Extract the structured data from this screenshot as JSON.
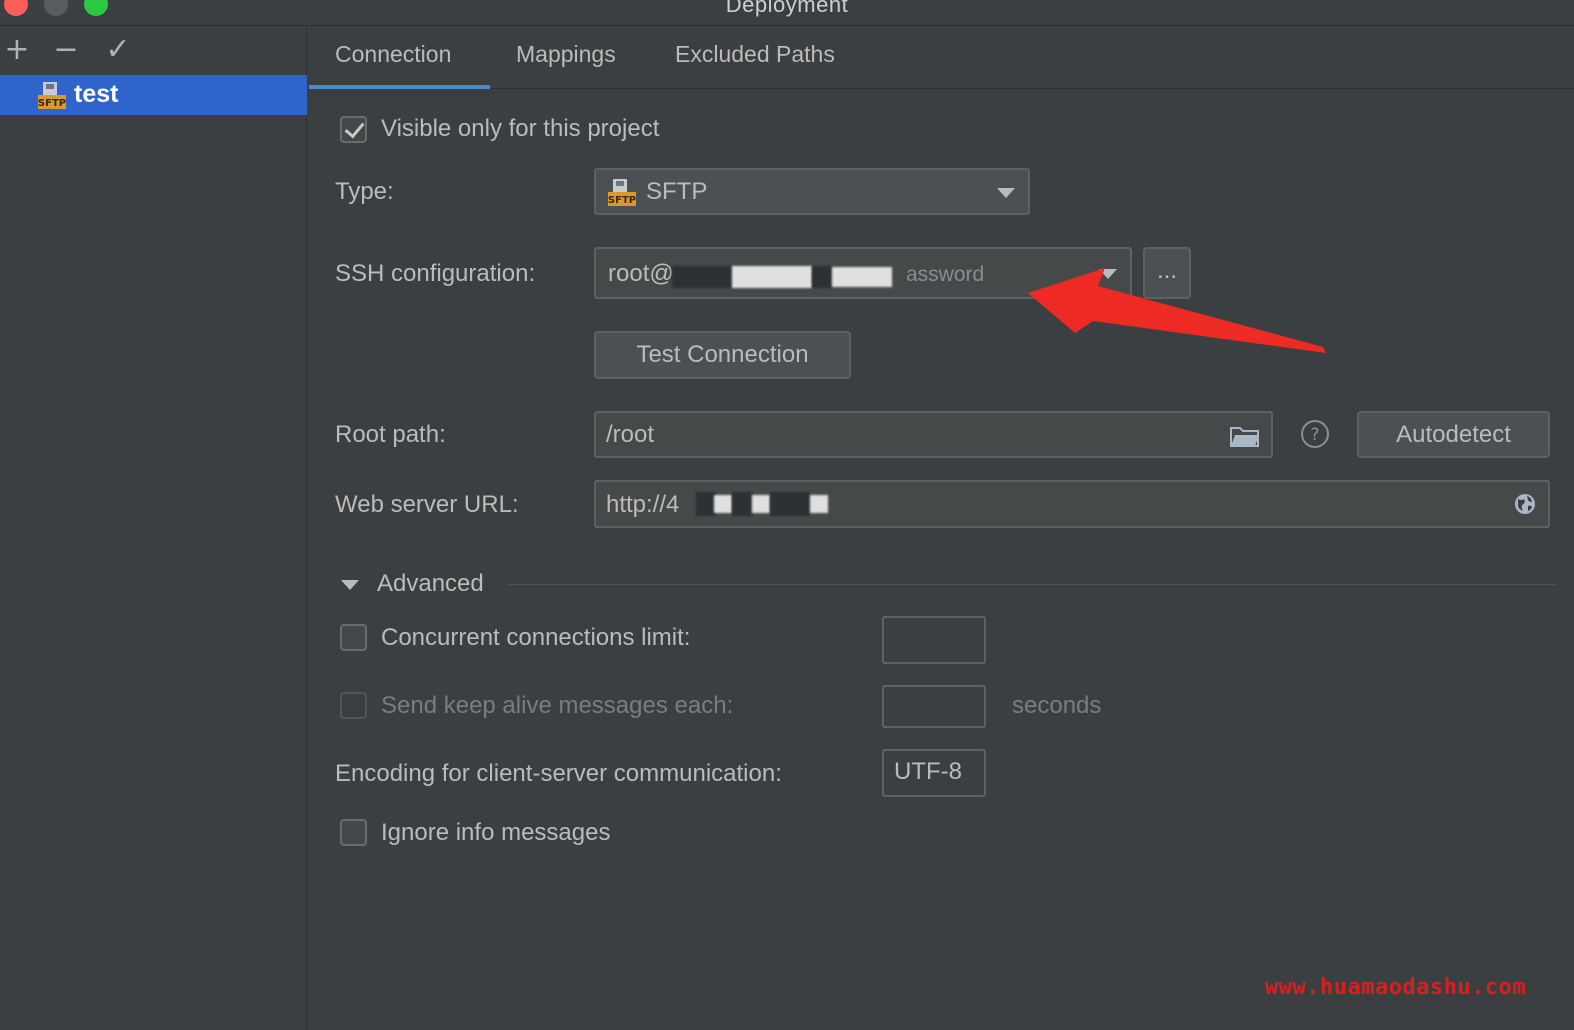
{
  "window": {
    "title": "Deployment"
  },
  "toolbar": {
    "add_symbol": "+",
    "remove_symbol": "−",
    "apply_symbol": "✓"
  },
  "servers": [
    {
      "name": "test",
      "icon": "sftp-icon",
      "icon_text": "SFTP"
    }
  ],
  "tabs": [
    {
      "label": "Connection",
      "active": true
    },
    {
      "label": "Mappings",
      "active": false
    },
    {
      "label": "Excluded Paths",
      "active": false
    }
  ],
  "connection": {
    "visible_only_label": "Visible only for this project",
    "visible_only_checked": true,
    "type_label": "Type:",
    "type_value": "SFTP",
    "ssh_label": "SSH configuration:",
    "ssh_value_prefix": "root@",
    "ssh_value_suffix": "assword",
    "ssh_browse": "...",
    "test_connection": "Test Connection",
    "root_path_label": "Root path:",
    "root_path_value": "/root",
    "help_symbol": "?",
    "autodetect": "Autodetect",
    "web_url_label": "Web server URL:",
    "web_url_value": "http://4"
  },
  "advanced": {
    "header": "Advanced",
    "concurrent_label": "Concurrent connections limit:",
    "concurrent_checked": false,
    "concurrent_value": "",
    "keepalive_label": "Send keep alive messages each:",
    "keepalive_checked": false,
    "keepalive_value": "",
    "keepalive_unit": "seconds",
    "encoding_label": "Encoding for client-server communication:",
    "encoding_value": "UTF-8",
    "ignore_info_label": "Ignore info messages",
    "ignore_info_checked": false
  },
  "watermark": "www.huamaodashu.com",
  "colors": {
    "background": "#3c3f41",
    "selection": "#2f65ca",
    "tab_underline": "#4a88c7",
    "annotation_arrow": "#ee2a24",
    "watermark": "#d62020"
  }
}
